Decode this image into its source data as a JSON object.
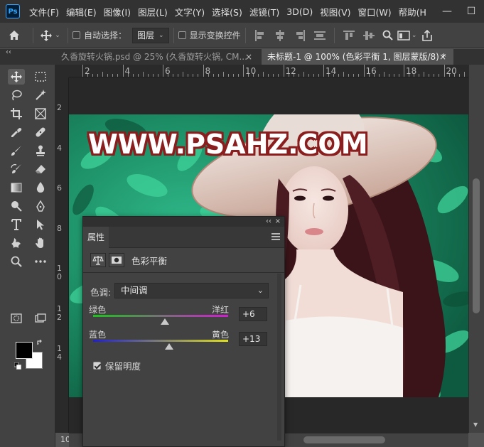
{
  "app": {
    "logo": "Ps",
    "menu": [
      "文件(F)",
      "编辑(E)",
      "图像(I)",
      "图层(L)",
      "文字(Y)",
      "选择(S)",
      "滤镜(T)",
      "3D(D)",
      "视图(V)",
      "窗口(W)",
      "帮助(H"
    ],
    "window_controls": {
      "minimize": "—",
      "maximize": "☐"
    }
  },
  "options_bar": {
    "home_icon": "home-icon",
    "move_icon": "move-icon",
    "auto_select_label": "自动选择：",
    "auto_select_value": "图层",
    "show_transform_label": "显示变换控件"
  },
  "tabs": [
    {
      "label": "久香旋转火锅.psd @ 25% (久香旋转火锅, CM...",
      "close": "×",
      "active": false
    },
    {
      "label": "未标题-1 @ 100% (色彩平衡 1, 图层蒙版/8) *",
      "close": "×",
      "active": true
    }
  ],
  "left_collapse": "‹‹",
  "rulers": {
    "top": [
      "2",
      "4",
      "6",
      "8",
      "10",
      "12",
      "14",
      "16",
      "18",
      "20"
    ],
    "left": [
      [
        "2"
      ],
      [
        "4"
      ],
      [
        "6"
      ],
      [
        "8"
      ],
      [
        "1",
        "0"
      ],
      [
        "1",
        "2"
      ],
      [
        "1",
        "4"
      ]
    ]
  },
  "canvas": {
    "watermark": "WWW.PSAHZ.COM",
    "colors": {
      "foliage": "#1e8a63",
      "foliage_light": "#33c08a",
      "hat": "#d8b9a8",
      "hair": "#4a1c22",
      "skin": "#f0ddd6",
      "dress": "#f5f1ef",
      "watermark_outline": "#8a1e1e"
    }
  },
  "status": {
    "zoom": "100%"
  },
  "properties_panel": {
    "tab": "属性",
    "collapse": "‹‹",
    "close": "×",
    "adjustment_title": "色彩平衡",
    "tone_label": "色调:",
    "tone_value": "中间调",
    "sliders": [
      {
        "left": "绿色",
        "right": "洋红",
        "value": "+6",
        "level": 6
      },
      {
        "left": "蓝色",
        "right": "黄色",
        "value": "+13",
        "level": 13
      }
    ],
    "preserve_luminosity": {
      "label": "保留明度",
      "checked": true
    }
  }
}
